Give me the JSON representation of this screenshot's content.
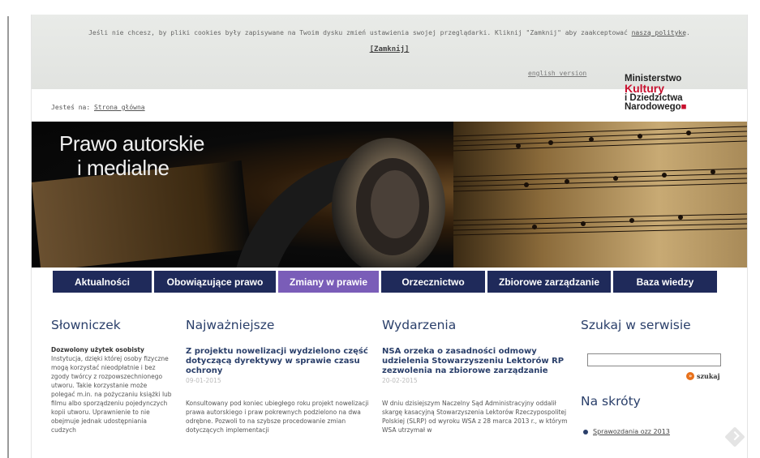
{
  "cookie": {
    "message": "Jeśli nie chcesz, by pliki cookies były zapisywane na Twoim dysku zmień ustawienia swojej przeglądarki. Kliknij \"Zamknij\" aby zaakceptować",
    "policy_link": "naszą politykę",
    "close_label": "[Zamknij]"
  },
  "header": {
    "english_link": "english version",
    "breadcrumb_prefix": "Jesteś na:",
    "breadcrumb_link": "Strona główna",
    "logo": {
      "line1": "Ministerstwo",
      "line2": "Kultury",
      "line3": "i Dziedzictwa",
      "line4": "Narodowego"
    }
  },
  "banner": {
    "title_line1": "Prawo autorskie",
    "title_line2": "i medialne"
  },
  "nav": [
    {
      "label": "Aktualności",
      "active": false
    },
    {
      "label": "Obowiązujące prawo",
      "active": false
    },
    {
      "label": "Zmiany w prawie",
      "active": true
    },
    {
      "label": "Orzecznictwo",
      "active": false
    },
    {
      "label": "Zbiorowe zarządzanie",
      "active": false
    },
    {
      "label": "Baza wiedzy",
      "active": false
    }
  ],
  "glossary": {
    "heading": "Słowniczek",
    "term": "Dozwolony użytek osobisty",
    "definition": "Instytucja, dzięki której osoby fizyczne mogą korzystać nieodpłatnie i bez zgody twórcy z rozpowszechnionego utworu. Takie korzystanie może polegać m.in. na pożyczaniu książki lub filmu albo sporządzeniu pojedynczych kopii utworu. Uprawnienie to nie obejmuje jednak udostępniania cudzych"
  },
  "important": {
    "heading": "Najważniejsze",
    "title": "Z projektu nowelizacji wydzielono część dotyczącą dyrektywy w sprawie czasu ochrony",
    "date": "09-01-2015",
    "body": "Konsultowany pod koniec ubiegłego roku projekt nowelizacji prawa autorskiego i praw pokrewnych podzielono na dwa odrębne. Pozwoli to na szybsze procedowanie zmian dotyczących implementacji"
  },
  "events": {
    "heading": "Wydarzenia",
    "title": "NSA orzeka o zasadności odmowy udzielenia Stowarzyszeniu Lektorów RP zezwolenia na zbiorowe zarządzanie",
    "date": "20-02-2015",
    "body": "W dniu dzisiejszym Naczelny Sąd Administracyjny oddalił skargę kasacyjną Stowarzyszenia Lektorów Rzeczypospolitej Polskiej (SLRP) od wyroku WSA z 28 marca 2013 r., w którym WSA utrzymał w"
  },
  "search": {
    "heading": "Szukaj w serwisie",
    "button_label": "szukaj"
  },
  "shortcuts": {
    "heading": "Na skróty",
    "items": [
      "Sprawozdania ozz 2013"
    ]
  }
}
